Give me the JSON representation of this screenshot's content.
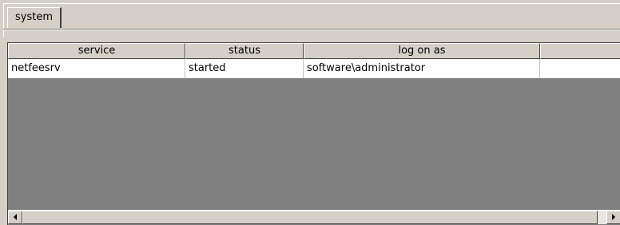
{
  "tabs": [
    {
      "label": "system",
      "selected": true
    }
  ],
  "table": {
    "columns": [
      "service",
      "status",
      "log on as",
      ""
    ],
    "rows": [
      [
        "netfeesrv",
        "started",
        "software\\administrator",
        ""
      ]
    ]
  },
  "scrollbar": {
    "left_icon": "arrow-left-icon",
    "right_icon": "arrow-right-icon"
  },
  "colors": {
    "face": "#d4d0c8",
    "listview_background": "#808080",
    "row_background": "#ffffff"
  }
}
